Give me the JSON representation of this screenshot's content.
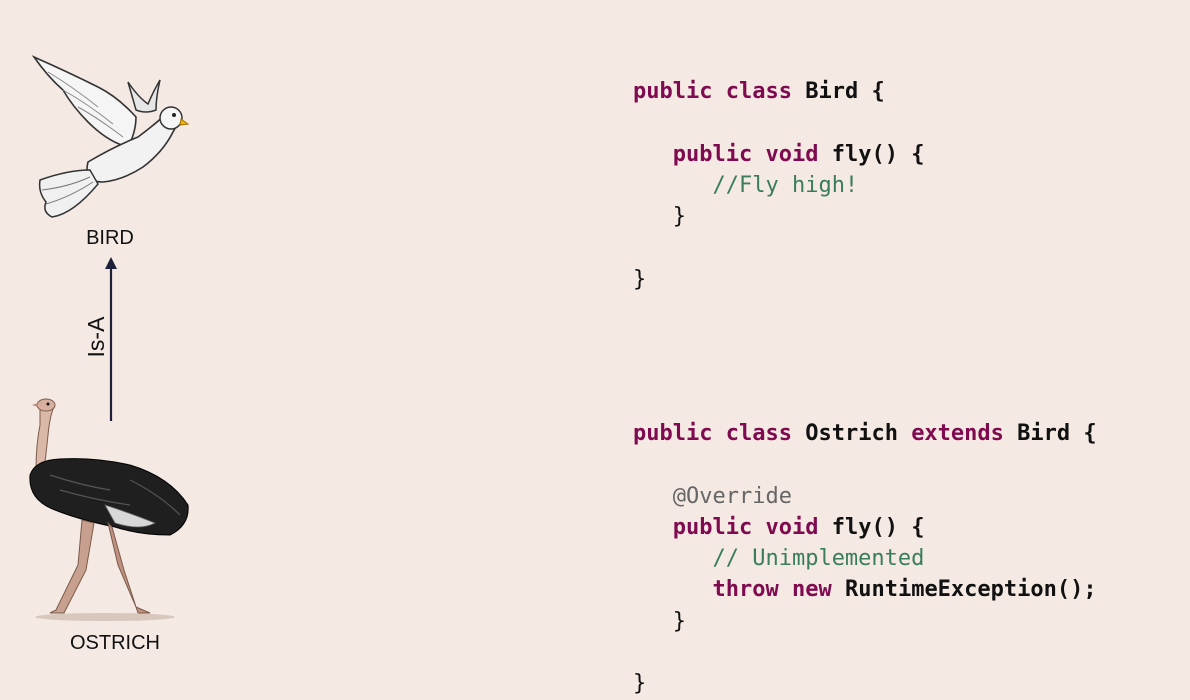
{
  "labels": {
    "bird": "BIRD",
    "ostrich": "OSTRICH",
    "relation": "Is-A"
  },
  "bird_class": {
    "line1": {
      "kw1": "public",
      "kw2": "class",
      "name": "Bird",
      "brace": "{"
    },
    "line2": {
      "kw1": "public",
      "kw2": "void",
      "name": "fly()",
      "brace": "{"
    },
    "line3": {
      "comment": "//Fly high!"
    },
    "line4": {
      "brace": "}"
    },
    "line5": {
      "brace": "}"
    }
  },
  "ostrich_class": {
    "line1": {
      "kw1": "public",
      "kw2": "class",
      "name": "Ostrich",
      "kw3": "extends",
      "parent": "Bird",
      "brace": "{"
    },
    "line2": {
      "annotation": "@Override"
    },
    "line3": {
      "kw1": "public",
      "kw2": "void",
      "name": "fly()",
      "brace": "{"
    },
    "line4": {
      "comment": "// Unimplemented"
    },
    "line5": {
      "kw1": "throw",
      "kw2": "new",
      "call": "RuntimeException();"
    },
    "line6": {
      "brace": "}"
    },
    "line7": {
      "brace": "}"
    }
  },
  "colors": {
    "background": "#f4e9e3",
    "keyword": "#7f0a4f",
    "comment": "#3a7d5a",
    "annotation": "#666666",
    "arrow": "#1f1f3a"
  }
}
